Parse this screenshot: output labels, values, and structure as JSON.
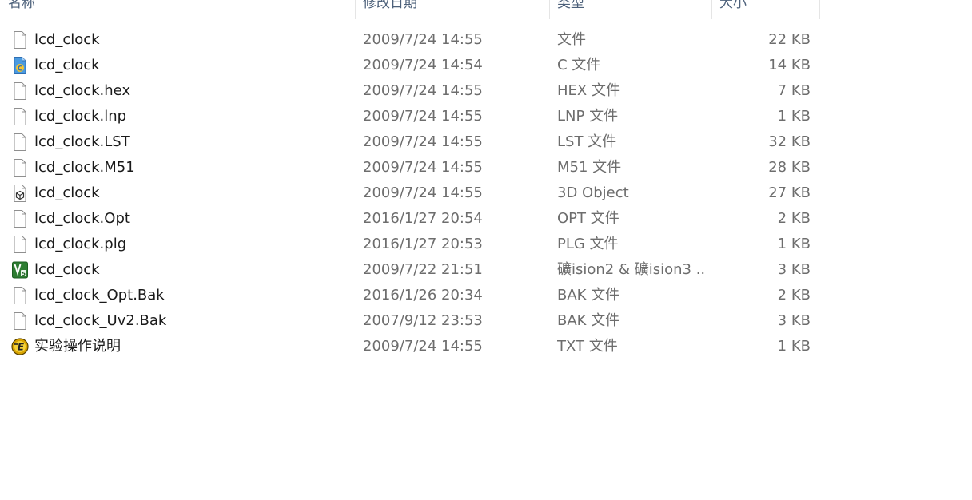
{
  "columns": {
    "name": "名称",
    "date": "修改日期",
    "type": "类型",
    "size": "大小"
  },
  "files": [
    {
      "name": "lcd_clock",
      "date": "2009/7/24 14:55",
      "type": "文件",
      "size": "22 KB",
      "icon": "blank-file-icon"
    },
    {
      "name": "lcd_clock",
      "date": "2009/7/24 14:54",
      "type": "C 文件",
      "size": "14 KB",
      "icon": "c-source-file-icon"
    },
    {
      "name": "lcd_clock.hex",
      "date": "2009/7/24 14:55",
      "type": "HEX 文件",
      "size": "7 KB",
      "icon": "blank-file-icon"
    },
    {
      "name": "lcd_clock.lnp",
      "date": "2009/7/24 14:55",
      "type": "LNP 文件",
      "size": "1 KB",
      "icon": "blank-file-icon"
    },
    {
      "name": "lcd_clock.LST",
      "date": "2009/7/24 14:55",
      "type": "LST 文件",
      "size": "32 KB",
      "icon": "blank-file-icon"
    },
    {
      "name": "lcd_clock.M51",
      "date": "2009/7/24 14:55",
      "type": "M51 文件",
      "size": "28 KB",
      "icon": "blank-file-icon"
    },
    {
      "name": "lcd_clock",
      "date": "2009/7/24 14:55",
      "type": "3D Object",
      "size": "27 KB",
      "icon": "3d-object-file-icon"
    },
    {
      "name": "lcd_clock.Opt",
      "date": "2016/1/27 20:54",
      "type": "OPT 文件",
      "size": "2 KB",
      "icon": "blank-file-icon"
    },
    {
      "name": "lcd_clock.plg",
      "date": "2016/1/27 20:53",
      "type": "PLG 文件",
      "size": "1 KB",
      "icon": "blank-file-icon"
    },
    {
      "name": "lcd_clock",
      "date": "2009/7/22 21:51",
      "type": "礦ision2 & 礦ision3 ...",
      "size": "3 KB",
      "icon": "keil-uvision-project-icon"
    },
    {
      "name": "lcd_clock_Opt.Bak",
      "date": "2016/1/26 20:34",
      "type": "BAK 文件",
      "size": "2 KB",
      "icon": "blank-file-icon"
    },
    {
      "name": "lcd_clock_Uv2.Bak",
      "date": "2007/9/12 23:53",
      "type": "BAK 文件",
      "size": "3 KB",
      "icon": "blank-file-icon"
    },
    {
      "name": "实验操作说明",
      "date": "2009/7/24 14:55",
      "type": "TXT 文件",
      "size": "1 KB",
      "icon": "text-editor-file-icon"
    }
  ]
}
